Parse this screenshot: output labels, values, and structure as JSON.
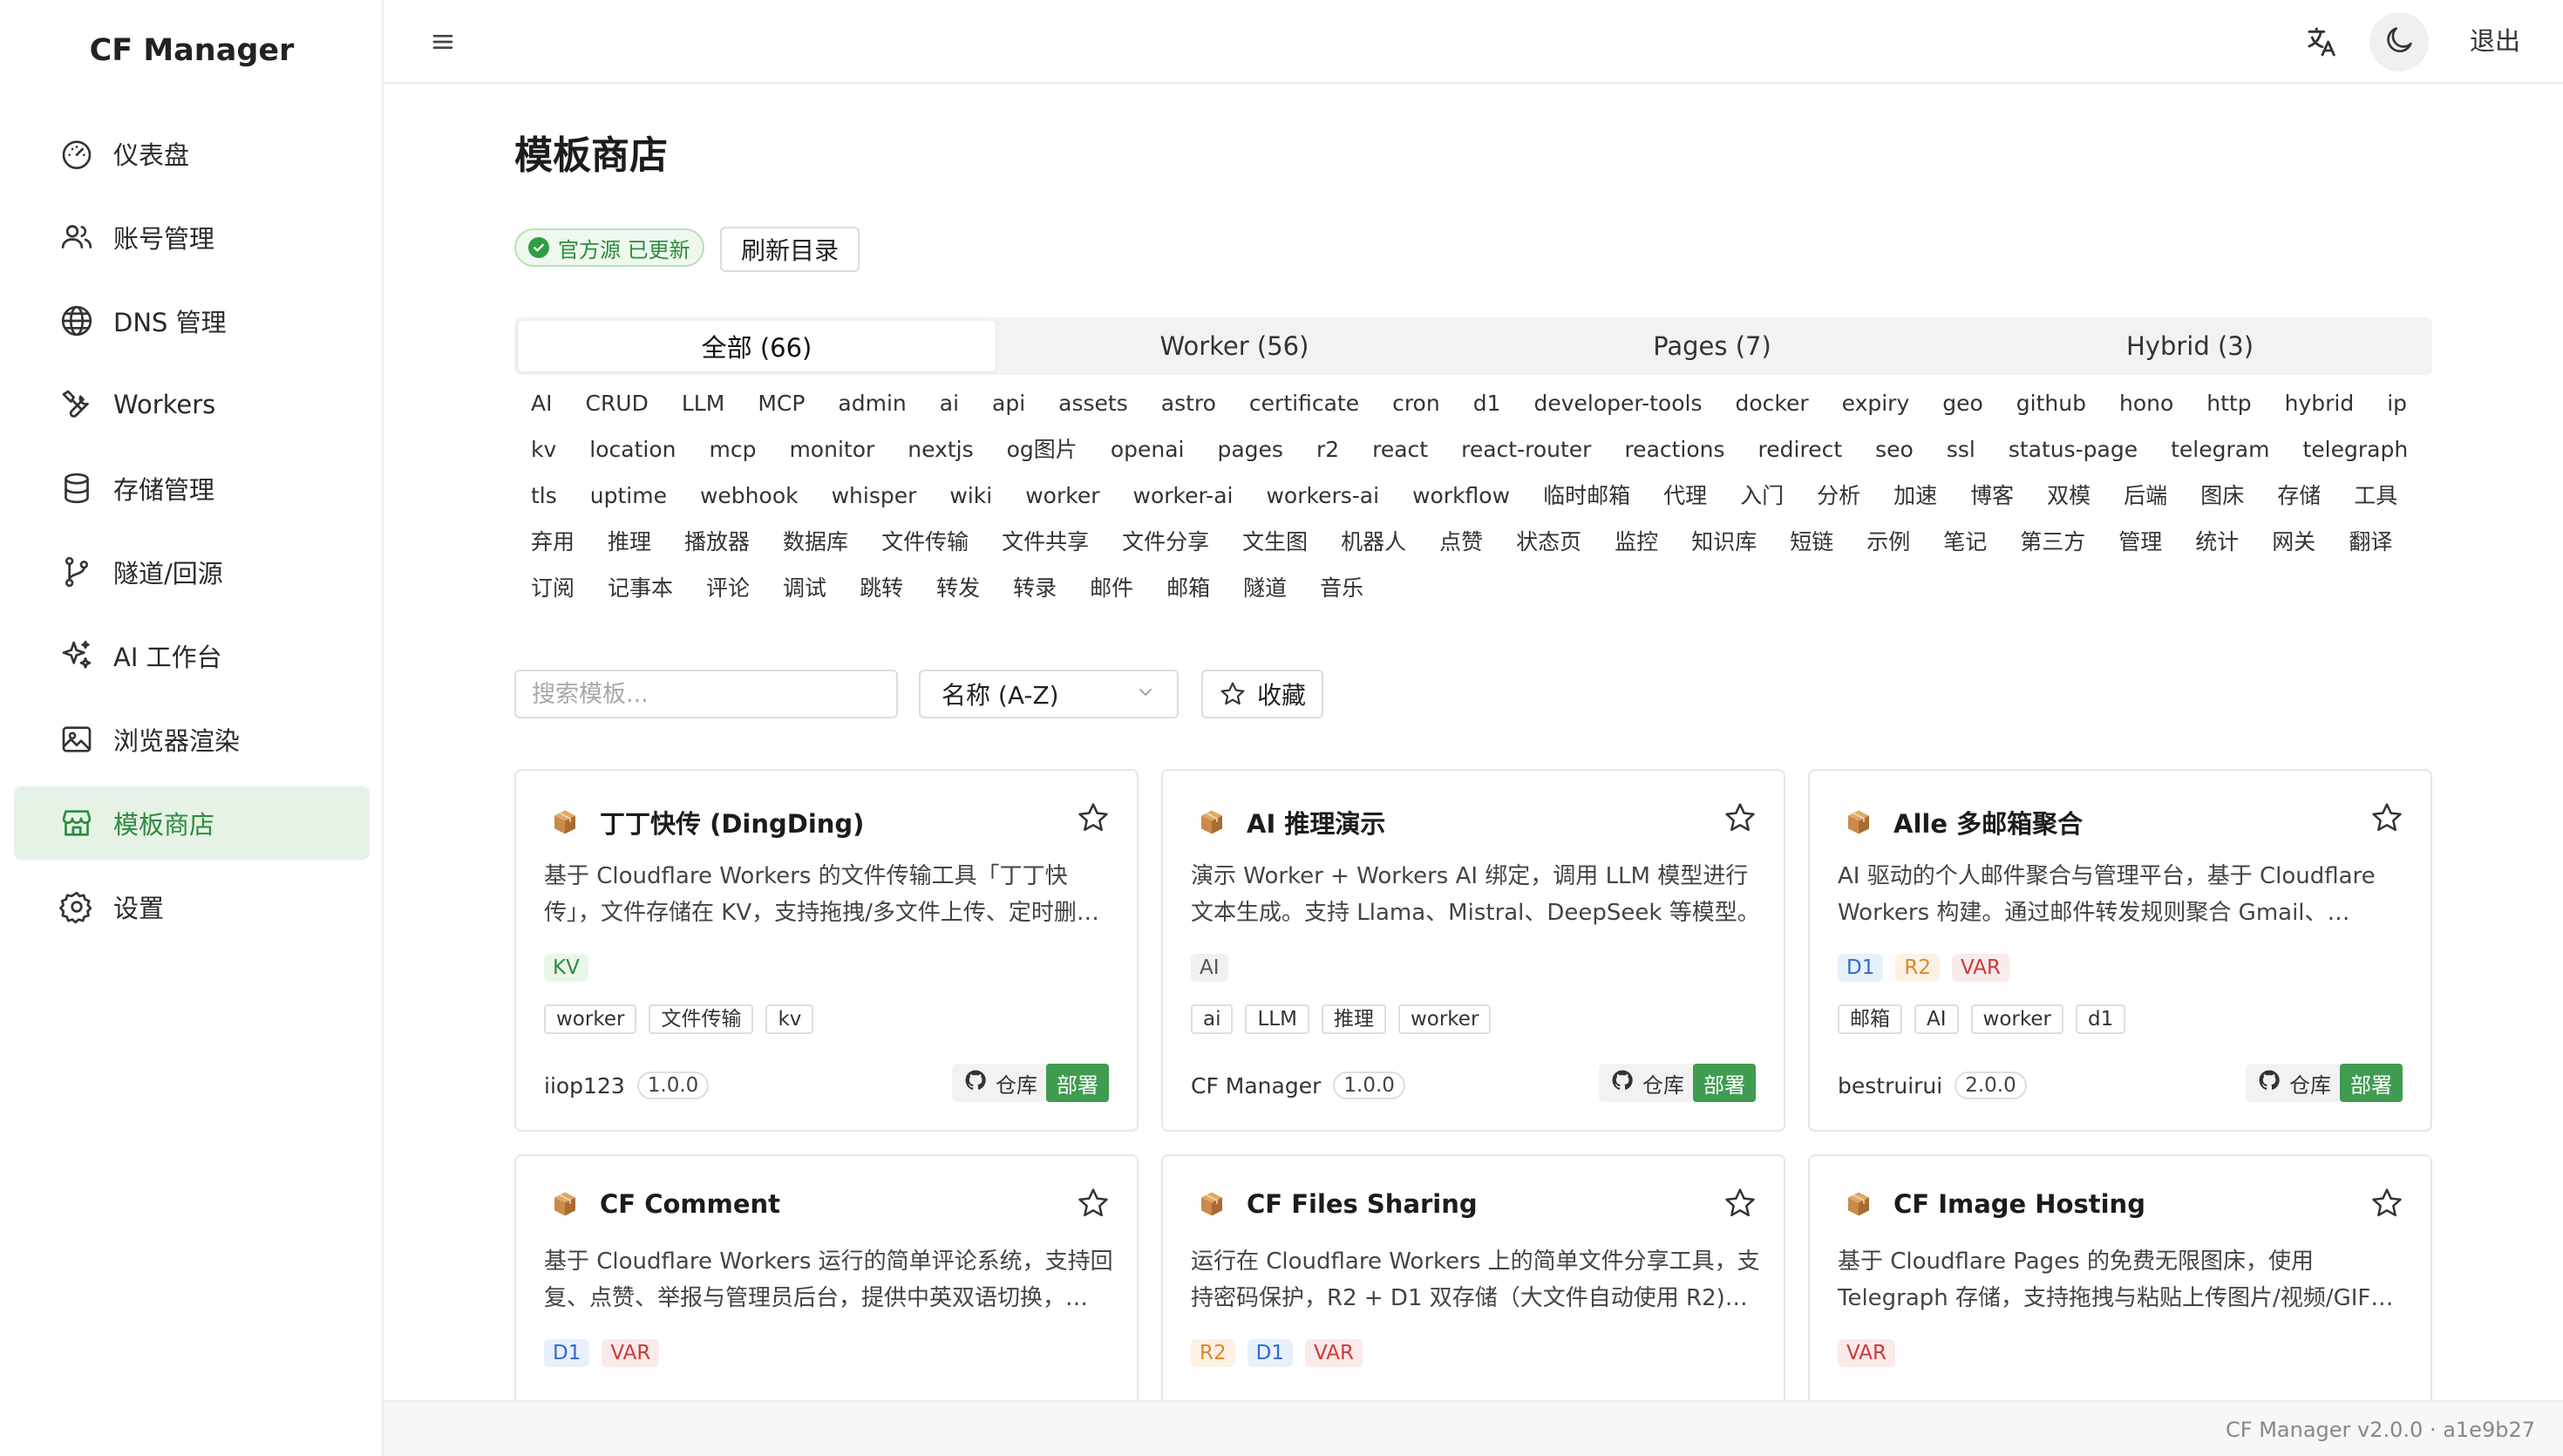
{
  "app": {
    "title": "CF Manager"
  },
  "sidebar": {
    "items": [
      {
        "label": "仪表盘",
        "icon": "dashboard-gauge-icon"
      },
      {
        "label": "账号管理",
        "icon": "users-icon"
      },
      {
        "label": "DNS 管理",
        "icon": "globe-icon"
      },
      {
        "label": "Workers",
        "icon": "tools-icon"
      },
      {
        "label": "存储管理",
        "icon": "database-icon"
      },
      {
        "label": "隧道/回源",
        "icon": "git-branch-icon"
      },
      {
        "label": "AI 工作台",
        "icon": "sparkles-icon"
      },
      {
        "label": "浏览器渲染",
        "icon": "image-icon"
      },
      {
        "label": "模板商店",
        "icon": "store-icon",
        "active": true
      },
      {
        "label": "设置",
        "icon": "gear-icon"
      }
    ]
  },
  "topbar": {
    "logout_label": "退出",
    "icons": [
      "menu-icon",
      "translate-icon",
      "moon-icon"
    ]
  },
  "main": {
    "title": "模板商店",
    "source_badge": "官方源 已更新",
    "refresh_label": "刷新目录",
    "tabs": [
      {
        "label": "全部 (66)",
        "active": true
      },
      {
        "label": "Worker (56)"
      },
      {
        "label": "Pages (7)"
      },
      {
        "label": "Hybrid (3)"
      }
    ],
    "tags": [
      "AI",
      "CRUD",
      "LLM",
      "MCP",
      "admin",
      "ai",
      "api",
      "assets",
      "astro",
      "certificate",
      "cron",
      "d1",
      "developer-tools",
      "docker",
      "expiry",
      "geo",
      "github",
      "hono",
      "http",
      "hybrid",
      "ip",
      "kv",
      "location",
      "mcp",
      "monitor",
      "nextjs",
      "og图片",
      "openai",
      "pages",
      "r2",
      "react",
      "react-router",
      "reactions",
      "redirect",
      "seo",
      "ssl",
      "status-page",
      "telegram",
      "telegraph",
      "tls",
      "uptime",
      "webhook",
      "whisper",
      "wiki",
      "worker",
      "worker-ai",
      "workers-ai",
      "workflow",
      "临时邮箱",
      "代理",
      "入门",
      "分析",
      "加速",
      "博客",
      "双模",
      "后端",
      "图床",
      "存储",
      "工具",
      "弃用",
      "推理",
      "播放器",
      "数据库",
      "文件传输",
      "文件共享",
      "文件分享",
      "文生图",
      "机器人",
      "点赞",
      "状态页",
      "监控",
      "知识库",
      "短链",
      "示例",
      "笔记",
      "第三方",
      "管理",
      "统计",
      "网关",
      "翻译",
      "订阅",
      "记事本",
      "评论",
      "调试",
      "跳转",
      "转发",
      "转录",
      "邮件",
      "邮箱",
      "隧道",
      "音乐"
    ],
    "search_placeholder": "搜索模板...",
    "sort_value": "名称 (A-Z)",
    "favorites_label": "收藏"
  },
  "cards": [
    {
      "title": "丁丁快传 (DingDing)",
      "desc": "基于 Cloudflare Workers 的文件传输工具「丁丁快传」，文件存储在 KV，支持拖拽/多文件上传、定时删…",
      "bindings": [
        "KV"
      ],
      "tags": [
        "worker",
        "文件传输",
        "kv"
      ],
      "author": "iiop123",
      "version": "1.0.0",
      "repo_label": "仓库",
      "deploy_label": "部署"
    },
    {
      "title": "AI 推理演示",
      "desc": "演示 Worker + Workers AI 绑定，调用 LLM 模型进行文本生成。支持 Llama、Mistral、DeepSeek 等模型。",
      "bindings": [
        "AI"
      ],
      "tags": [
        "ai",
        "LLM",
        "推理",
        "worker"
      ],
      "author": "CF Manager",
      "version": "1.0.0",
      "repo_label": "仓库",
      "deploy_label": "部署"
    },
    {
      "title": "Alle 多邮箱聚合",
      "desc": "AI 驱动的个人邮件聚合与管理平台，基于 Cloudflare Workers 构建。通过邮件转发规则聚合 Gmail、…",
      "bindings": [
        "D1",
        "R2",
        "VAR"
      ],
      "tags": [
        "邮箱",
        "AI",
        "worker",
        "d1"
      ],
      "author": "bestruirui",
      "version": "2.0.0",
      "repo_label": "仓库",
      "deploy_label": "部署"
    },
    {
      "title": "CF Comment",
      "desc": "基于 Cloudflare Workers 运行的简单评论系统，支持回复、点赞、举报与管理员后台，提供中英双语切换，…",
      "bindings": [
        "D1",
        "VAR"
      ],
      "tags": [],
      "author": "",
      "version": "",
      "repo_label": "",
      "deploy_label": ""
    },
    {
      "title": "CF Files Sharing",
      "desc": "运行在 Cloudflare Workers 上的简单文件分享工具，支持密码保护，R2 + D1 双存储（大文件自动使用 R2)…",
      "bindings": [
        "R2",
        "D1",
        "VAR"
      ],
      "tags": [],
      "author": "",
      "version": "",
      "repo_label": "",
      "deploy_label": ""
    },
    {
      "title": "CF Image Hosting",
      "desc": "基于 Cloudflare Pages 的免费无限图床，使用 Telegraph 存储，支持拖拽与粘贴上传图片/视频/GIF…",
      "bindings": [
        "VAR"
      ],
      "tags": [],
      "author": "",
      "version": "",
      "repo_label": "",
      "deploy_label": ""
    }
  ],
  "footer": {
    "text": "CF Manager v2.0.0 · a1e9b27"
  },
  "colors": {
    "accent": "#3f9c50",
    "active_bg": "#e6f2e6",
    "active_text": "#2e8b3e"
  }
}
